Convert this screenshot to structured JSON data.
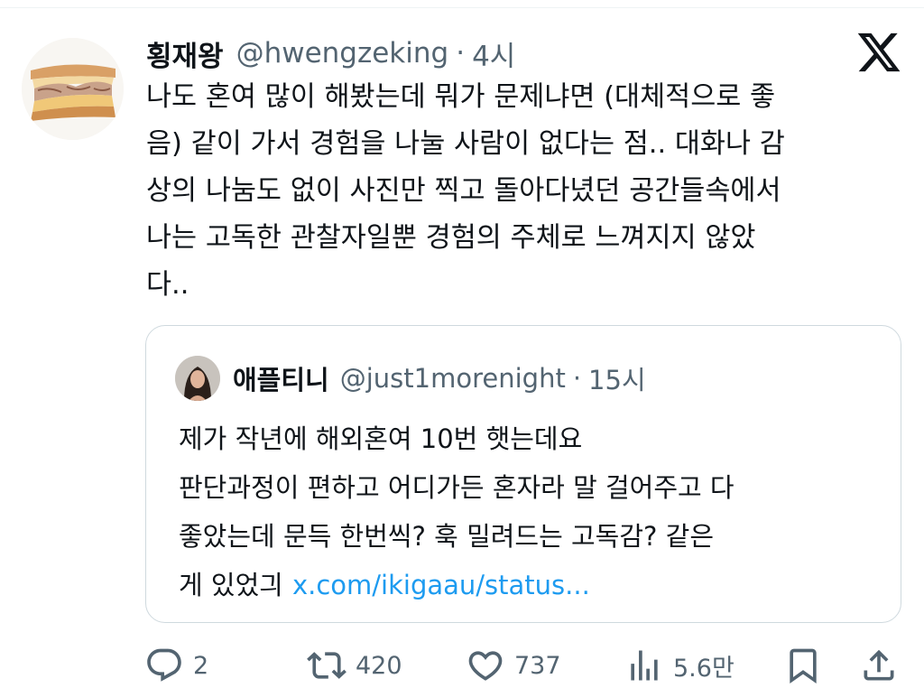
{
  "tweet": {
    "display_name": "횡재왕",
    "handle": "@hwengzeking",
    "dot": "·",
    "time": "4시",
    "text_lines": [
      "나도 혼여 많이 해봤는데 뭐가 문제냐면 (대체적으로 좋",
      "음) 같이 가서 경험을 나눌 사람이 없다는 점.. 대화나 감",
      "상의 나눔도 없이 사진만 찍고 돌아다녔던 공간들속에서",
      "나는 고독한 관찰자일뿐 경험의 주체로 느껴지지 않았",
      "다.."
    ]
  },
  "quote": {
    "display_name": "애플티니",
    "handle": "@just1morenight",
    "dot": "·",
    "time": "15시",
    "text_lines": [
      "제가 작년에 해외혼여 10번 햇는데요",
      "판단과정이 편하고 어디가든 혼자라 말 걸어주고 다",
      "좋았는데 문득 한번씩? 훅 밀려드는 고독감? 같은",
      "게 있었긔"
    ],
    "link_text": "x.com/ikigaau/status..."
  },
  "actions": {
    "reply_count": "2",
    "retweet_count": "420",
    "like_count": "737",
    "views_count": "5.6만"
  },
  "colors": {
    "text": "#0f1419",
    "secondary": "#536471",
    "link": "#1d9bf0",
    "border": "#cfd9de"
  },
  "icons": [
    "sandwich-avatar",
    "x-logo-icon",
    "reply-icon",
    "retweet-icon",
    "like-icon",
    "views-icon",
    "bookmark-icon",
    "share-icon"
  ]
}
